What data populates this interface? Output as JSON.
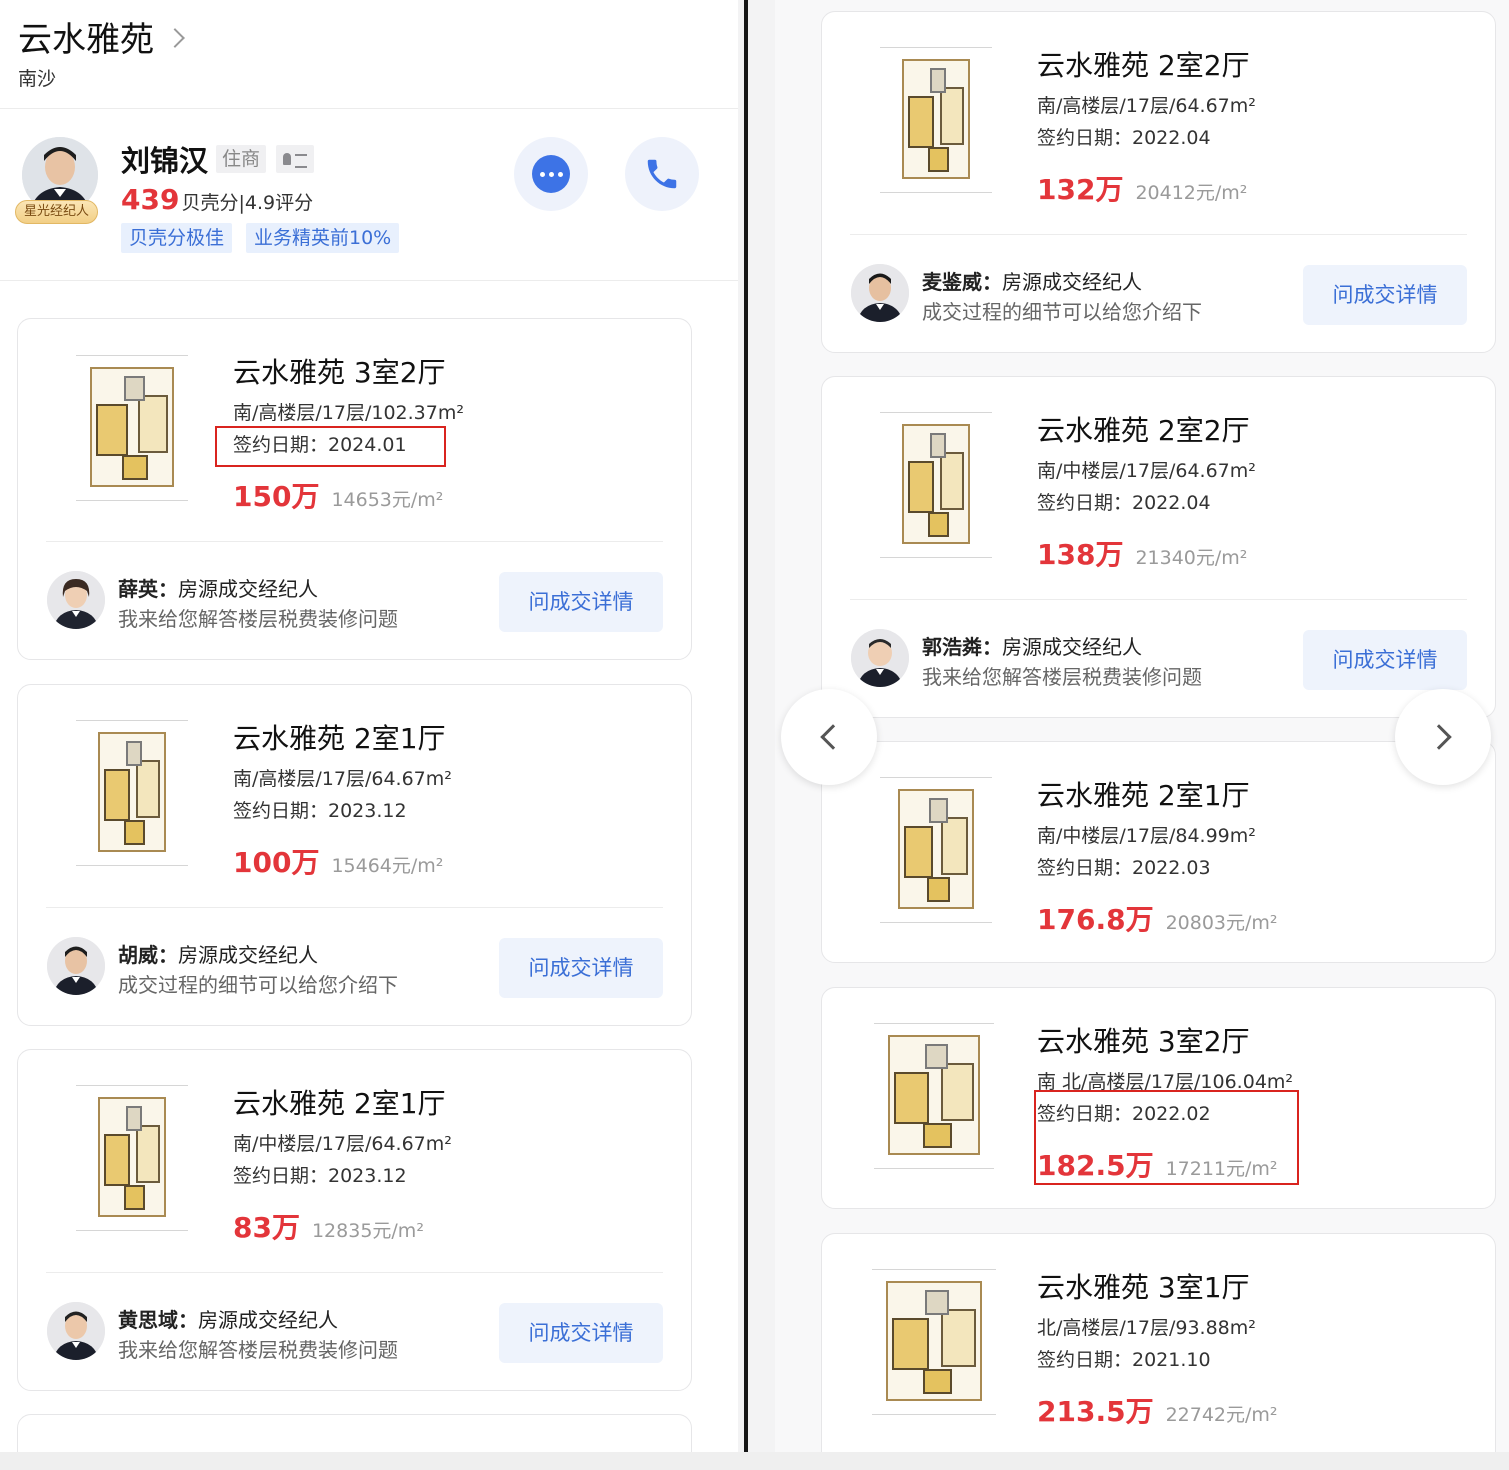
{
  "header": {
    "community_name": "云水雅苑",
    "area": "南沙"
  },
  "agent": {
    "name": "刘锦汉",
    "tag": "住商",
    "badge": "星光经纪人",
    "score": "439",
    "score_text": "贝壳分|4.9评分",
    "pills": [
      "贝壳分极佳",
      "业务精英前10%"
    ],
    "chat_icon": "chat-bubble-icon",
    "phone_icon": "phone-icon"
  },
  "left_listings": [
    {
      "title": "云水雅苑 3室2厅",
      "meta": "南/高楼层/17层/102.37m²",
      "date": "签约日期：2024.01",
      "price": "150万",
      "unit_price": "14653元/m²",
      "agent_name": "薛英：",
      "agent_role": "房源成交经纪人",
      "agent_msg": "我来给您解答楼层税费装修问题",
      "button": "问成交详情"
    },
    {
      "title": "云水雅苑 2室1厅",
      "meta": "南/高楼层/17层/64.67m²",
      "date": "签约日期：2023.12",
      "price": "100万",
      "unit_price": "15464元/m²",
      "agent_name": "胡威：",
      "agent_role": "房源成交经纪人",
      "agent_msg": "成交过程的细节可以给您介绍下",
      "button": "问成交详情"
    },
    {
      "title": "云水雅苑 2室1厅",
      "meta": "南/中楼层/17层/64.67m²",
      "date": "签约日期：2023.12",
      "price": "83万",
      "unit_price": "12835元/m²",
      "agent_name": "黄思域：",
      "agent_role": "房源成交经纪人",
      "agent_msg": "我来给您解答楼层税费装修问题",
      "button": "问成交详情"
    }
  ],
  "right_listings": [
    {
      "title": "云水雅苑 2室2厅",
      "meta": "南/高楼层/17层/64.67m²",
      "date": "签约日期：2022.04",
      "price": "132万",
      "unit_price": "20412元/m²",
      "agent_name": "麦鉴威：",
      "agent_role": "房源成交经纪人",
      "agent_msg": "成交过程的细节可以给您介绍下",
      "button": "问成交详情"
    },
    {
      "title": "云水雅苑 2室2厅",
      "meta": "南/中楼层/17层/64.67m²",
      "date": "签约日期：2022.04",
      "price": "138万",
      "unit_price": "21340元/m²",
      "agent_name": "郭浩粦：",
      "agent_role": "房源成交经纪人",
      "agent_msg": "我来给您解答楼层税费装修问题",
      "button": "问成交详情"
    },
    {
      "title": "云水雅苑 2室1厅",
      "meta": "南/中楼层/17层/84.99m²",
      "date": "签约日期：2022.03",
      "price": "176.8万",
      "unit_price": "20803元/m²"
    },
    {
      "title": "云水雅苑 3室2厅",
      "meta": "南 北/高楼层/17层/106.04m²",
      "date": "签约日期：2022.02",
      "price": "182.5万",
      "unit_price": "17211元/m²"
    },
    {
      "title": "云水雅苑 3室1厅",
      "meta": "北/高楼层/17层/93.88m²",
      "date": "签约日期：2021.10",
      "price": "213.5万",
      "unit_price": "22742元/m²"
    }
  ],
  "colors": {
    "price_red": "#e3353a",
    "link_blue": "#3b6fd6",
    "highlight_red": "#d9241f"
  }
}
